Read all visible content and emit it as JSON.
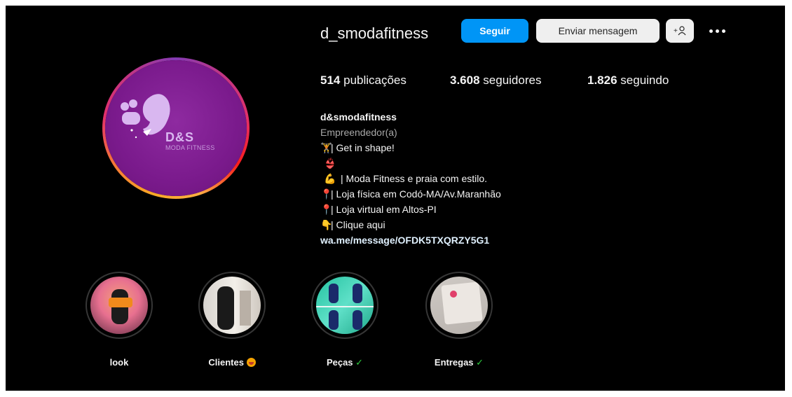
{
  "profile": {
    "username": "d_smodafitness",
    "logo_text": "D&S",
    "logo_subtext": "MODA FITNESS"
  },
  "actions": {
    "follow": "Seguir",
    "message": "Enviar mensagem",
    "add_user": "+⌂"
  },
  "stats": {
    "posts_count": "514",
    "posts_label": "publicações",
    "followers_count": "3.608",
    "followers_label": "seguidores",
    "following_count": "1.826",
    "following_label": "seguindo"
  },
  "bio": {
    "name": "d&smodafitness",
    "category": "Empreendedor(a)",
    "lines": [
      {
        "emoji": "🏋",
        "text": "| Get in shape!"
      },
      {
        "emoji": "👙💪",
        "text": "| Moda Fitness e praia com estilo."
      },
      {
        "emoji": "📍",
        "text": "| Loja física em Codó-MA/Av.Maranhão"
      },
      {
        "emoji": "📍",
        "text": "| Loja virtual em Altos-PI"
      },
      {
        "emoji": "👇",
        "text": "| Clique aqui"
      }
    ],
    "link": "wa.me/message/OFDK5TXQRZY5G1"
  },
  "highlights": [
    {
      "label": "look"
    },
    {
      "label": "Clientes"
    },
    {
      "label": "Peças"
    },
    {
      "label": "Entregas"
    }
  ],
  "colors": {
    "background": "#000000",
    "follow_button": "#0095f6",
    "secondary_button": "#efefef",
    "avatar_purple": "#7a1a8c"
  }
}
